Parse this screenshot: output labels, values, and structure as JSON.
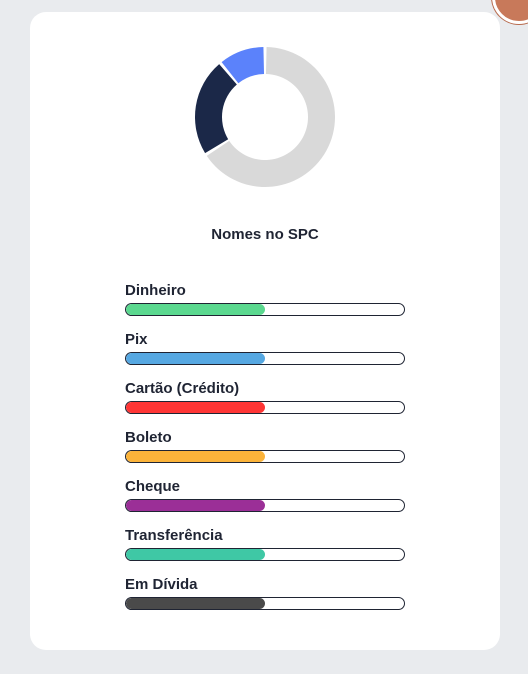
{
  "card": {
    "title": "Nomes no SPC"
  },
  "chart_data": {
    "type": "pie",
    "variant": "donut",
    "slices": [
      {
        "value": 66,
        "color": "#d9d9d9"
      },
      {
        "value": 23,
        "color": "#1b2848"
      },
      {
        "value": 11,
        "color": "#5b82fb"
      }
    ]
  },
  "payment_methods": [
    {
      "label": "Dinheiro",
      "progress": 0.5,
      "color": "#5bd88f"
    },
    {
      "label": "Pix",
      "progress": 0.5,
      "color": "#56a8e2"
    },
    {
      "label": "Cartão (Crédito)",
      "progress": 0.5,
      "color": "#ff3535"
    },
    {
      "label": "Boleto",
      "progress": 0.5,
      "color": "#fbb33a"
    },
    {
      "label": "Cheque",
      "progress": 0.5,
      "color": "#9b2f97"
    },
    {
      "label": "Transferência",
      "progress": 0.5,
      "color": "#3fc8a5"
    },
    {
      "label": "Em Dívida",
      "progress": 0.5,
      "color": "#4a4a4a"
    }
  ]
}
